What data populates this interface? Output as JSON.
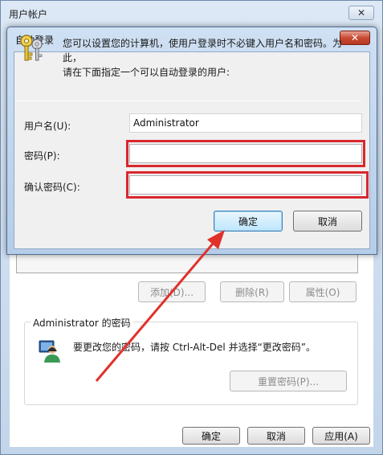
{
  "background_window": {
    "title": "用户帐户",
    "buttons": {
      "add": "添加(D)...",
      "remove": "删除(R)",
      "properties": "属性(O)"
    },
    "password_group": {
      "title": "Administrator 的密码",
      "text": "要更改您的密码，请按 Ctrl-Alt-Del 并选择“更改密码”。",
      "reset_button": "重置密码(P)..."
    },
    "footer": {
      "ok": "确定",
      "cancel": "取消",
      "apply": "应用(A)"
    }
  },
  "dialog": {
    "title": "自动登录",
    "description_line1": "您可以设置您的计算机，使用户登录时不必键入用户名和密码。为此，",
    "description_line2": "请在下面指定一个可以自动登录的用户:",
    "username_label": "用户名(U):",
    "username_value": "Administrator",
    "password_label": "密码(P):",
    "password_value": "",
    "confirm_label": "确认密码(C):",
    "confirm_value": "",
    "ok_button": "确定",
    "cancel_button": "取消"
  },
  "colors": {
    "highlight": "#d9272e",
    "arrow": "#e0312b"
  }
}
